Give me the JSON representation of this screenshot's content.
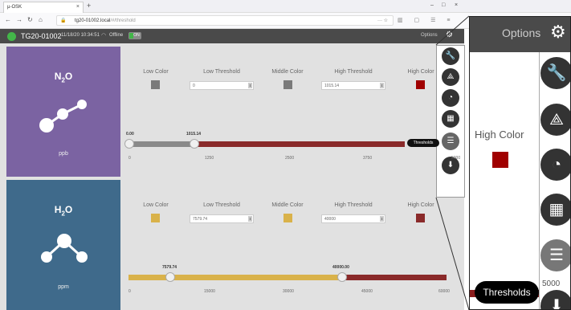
{
  "browser": {
    "tab_title": "μ-OSK",
    "url_host": "tg20-01002.local",
    "url_path": "/#/threshold",
    "win_min": "–",
    "win_max": "□",
    "win_close": "×"
  },
  "header": {
    "device": "TG20-01002",
    "datetime": "11/18/20 10:34:51",
    "status": "Offline",
    "toggle": "ON",
    "options": "Options"
  },
  "gases": [
    {
      "formula_base": "N",
      "formula_sub": "2",
      "formula_tail": "O",
      "unit": "ppb",
      "tile_color": "#7b63a2",
      "low_color_label": "Low Color",
      "low_color": "#7a7a7a",
      "low_threshold_label": "Low Threshold",
      "low_threshold": "0",
      "middle_color_label": "Middle Color",
      "middle_color": "#7a7a7a",
      "high_threshold_label": "High Threshold",
      "high_threshold": "1015.14",
      "high_color_label": "High Color",
      "high_color": "#a00000",
      "low_marker": "0.00",
      "high_marker": "1015.14",
      "ticks": [
        "0",
        "1250",
        "2500",
        "3750",
        "5000"
      ]
    },
    {
      "formula_base": "H",
      "formula_sub": "2",
      "formula_tail": "O",
      "unit": "ppm",
      "tile_color": "#3f6a8b",
      "low_color_label": "Low Color",
      "low_color": "#d9b24a",
      "low_threshold_label": "Low Threshold",
      "low_threshold": "7579.74",
      "middle_color_label": "Middle Color",
      "middle_color": "#d9b24a",
      "high_threshold_label": "High Threshold",
      "high_threshold": "40000",
      "high_color_label": "High Color",
      "high_color": "#8a2a2a",
      "low_marker": "7579.74",
      "high_marker": "40000.00",
      "ticks": [
        "0",
        "15000",
        "30000",
        "45000",
        "60000"
      ]
    }
  ],
  "fabs": [
    "wrench-icon",
    "compass-icon",
    "gauge-icon",
    "layout-icon",
    "sliders-icon",
    "download-icon"
  ],
  "tooltip": "Thresholds",
  "zoom": {
    "options": "Options",
    "high_color_label": "High Color",
    "tooltip": "Thresholds",
    "tick": "5000"
  }
}
